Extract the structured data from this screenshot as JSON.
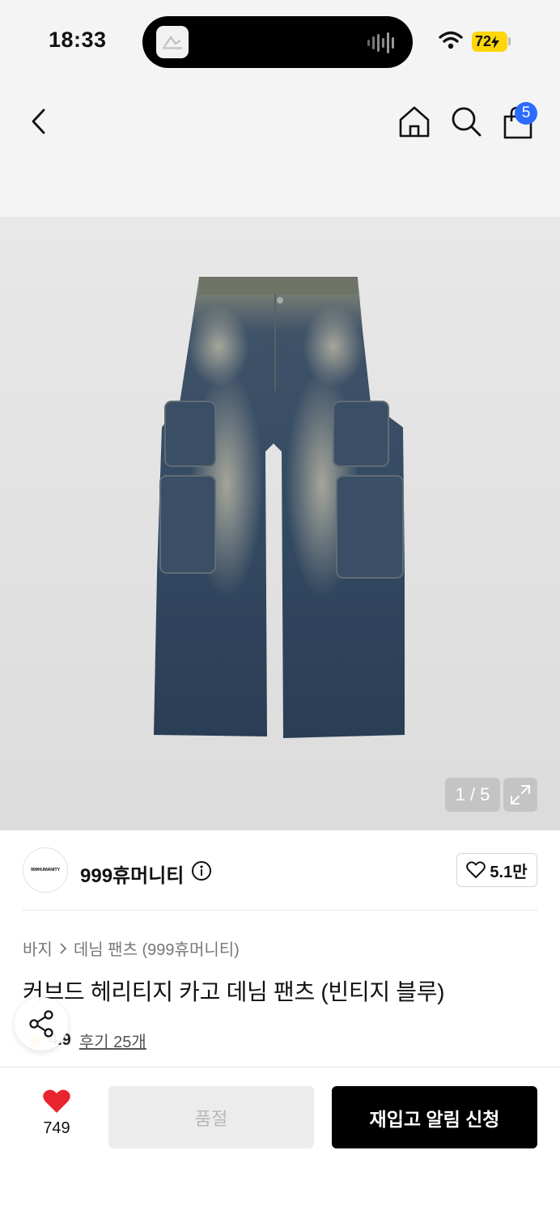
{
  "status_bar": {
    "time": "18:33",
    "battery": "72",
    "battery_color": "#ffd60a"
  },
  "header": {
    "icons": [
      "back-icon",
      "home-icon",
      "search-icon",
      "bag-icon"
    ],
    "cart_count": "5",
    "badge_color": "#2b6bff"
  },
  "gallery": {
    "page_indicator": "1 / 5",
    "icon": "expand-icon"
  },
  "brand": {
    "logo_text": "999HUMANITY",
    "name": "999휴머니티",
    "like_count": "5.1만"
  },
  "product": {
    "breadcrumb": [
      "바지",
      "데님 팬츠 (999휴머니티)"
    ],
    "title": "커브드 헤리티지 카고 데님 팬츠 (빈티지 블루)",
    "rating": "4.9",
    "reviews": "후기 25개"
  },
  "bottom_bar": {
    "like_count": "749",
    "soldout_label": "품절",
    "restock_label": "재입고 알림 신청",
    "heart_color": "#e8242c"
  }
}
